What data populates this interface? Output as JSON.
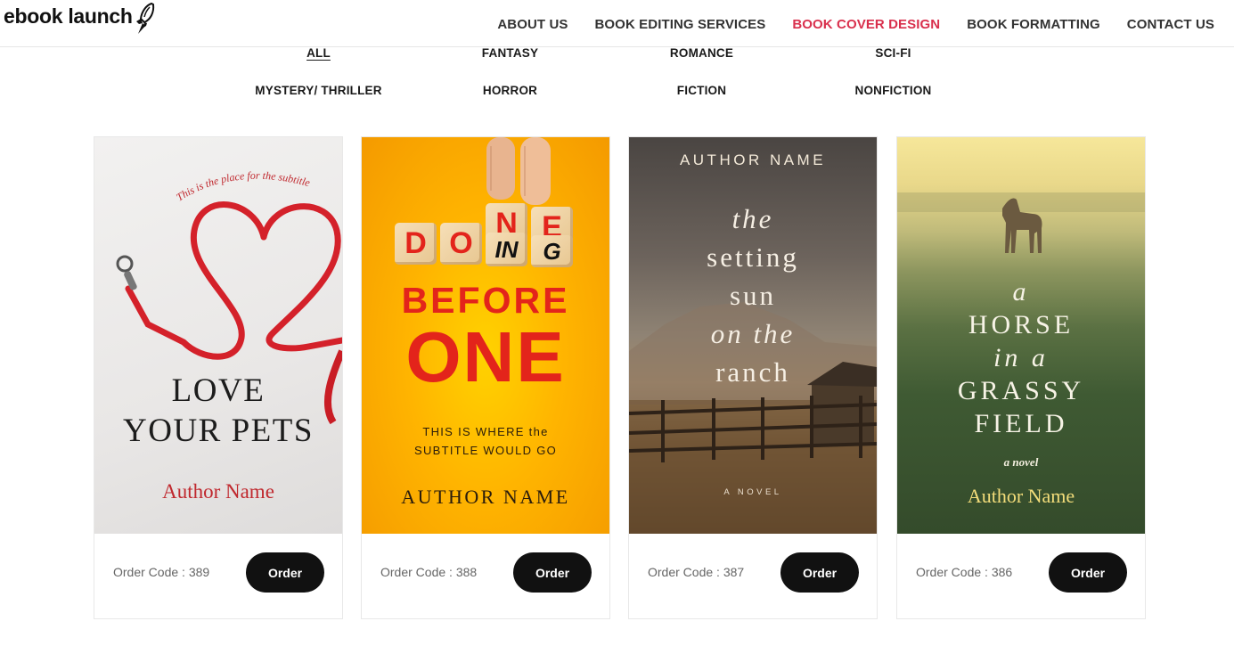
{
  "header": {
    "logo_text": "ebook launch",
    "logo_icon": "rocket-icon",
    "nav": [
      {
        "label": "ABOUT US"
      },
      {
        "label": "BOOK EDITING SERVICES"
      },
      {
        "label": "BOOK COVER DESIGN",
        "active": true
      },
      {
        "label": "BOOK FORMATTING"
      },
      {
        "label": "CONTACT US"
      }
    ]
  },
  "filters": {
    "active": "ALL",
    "items": [
      "ALL",
      "FANTASY",
      "ROMANCE",
      "SCI-FI",
      "MYSTERY/ THRILLER",
      "HORROR",
      "FICTION",
      "NONFICTION"
    ]
  },
  "books": [
    {
      "subtitle": "This is the place for the subtitle",
      "title_lines": [
        "LOVE",
        "YOUR PETS"
      ],
      "author": "Author Name",
      "order_code": "Order Code : 389",
      "order_label": "Order"
    },
    {
      "cubes": [
        "D",
        "O",
        "N",
        "E",
        "IN",
        "G"
      ],
      "title_lines": [
        "BEFORE",
        "ONE"
      ],
      "subtitle_lines": [
        "THIS IS WHERE the",
        "SUBTITLE WOULD GO"
      ],
      "author": "AUTHOR NAME",
      "order_code": "Order Code : 388",
      "order_label": "Order"
    },
    {
      "author": "AUTHOR NAME",
      "title_lines": [
        "the",
        "setting",
        "sun",
        "on the",
        "ranch"
      ],
      "tagline": "A NOVEL",
      "order_code": "Order Code : 387",
      "order_label": "Order"
    },
    {
      "title_lines": [
        "a",
        "HORSE",
        "in a",
        "GRASSY",
        "FIELD"
      ],
      "tagline": "a novel",
      "author": "Author Name",
      "order_code": "Order Code : 386",
      "order_label": "Order"
    }
  ],
  "colors": {
    "accent": "#d9304d",
    "button": "#111111",
    "cover_red": "#e3241b"
  }
}
